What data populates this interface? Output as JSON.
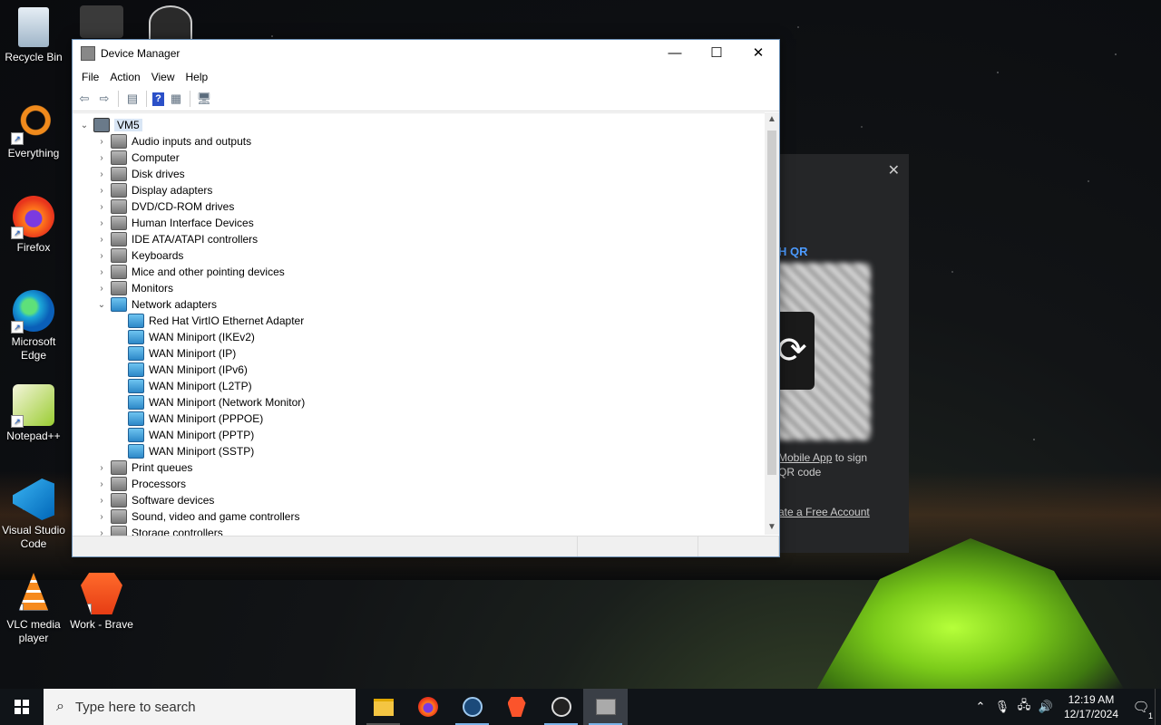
{
  "desktop": {
    "icons": [
      {
        "label": "Recycle Bin"
      },
      {
        "label": "Everything"
      },
      {
        "label": "Firefox"
      },
      {
        "label": "Microsoft Edge"
      },
      {
        "label": "Notepad++"
      },
      {
        "label": "Visual Studio Code"
      },
      {
        "label": "VLC media player"
      },
      {
        "label": "Work - Brave"
      }
    ]
  },
  "bg_app": {
    "qr_title": "H QR",
    "line1_link": "Mobile App",
    "line1_rest": " to sign",
    "line2": "QR code",
    "line3": "ate a Free Account",
    "close": "✕"
  },
  "window": {
    "title": "Device Manager",
    "controls": {
      "minimize": "—",
      "maximize": "☐",
      "close": "✕"
    },
    "menu": [
      "File",
      "Action",
      "View",
      "Help"
    ],
    "root": "VM5",
    "categories_before": [
      "Audio inputs and outputs",
      "Computer",
      "Disk drives",
      "Display adapters",
      "DVD/CD-ROM drives",
      "Human Interface Devices",
      "IDE ATA/ATAPI controllers",
      "Keyboards",
      "Mice and other pointing devices",
      "Monitors"
    ],
    "expanded_category": "Network adapters",
    "network_adapters": [
      "Red Hat VirtIO Ethernet Adapter",
      "WAN Miniport (IKEv2)",
      "WAN Miniport (IP)",
      "WAN Miniport (IPv6)",
      "WAN Miniport (L2TP)",
      "WAN Miniport (Network Monitor)",
      "WAN Miniport (PPPOE)",
      "WAN Miniport (PPTP)",
      "WAN Miniport (SSTP)"
    ],
    "categories_after": [
      "Print queues",
      "Processors",
      "Software devices",
      "Sound, video and game controllers",
      "Storage controllers"
    ]
  },
  "taskbar": {
    "search_placeholder": "Type here to search",
    "time": "12:19 AM",
    "date": "12/17/2024",
    "notification_count": "1"
  }
}
